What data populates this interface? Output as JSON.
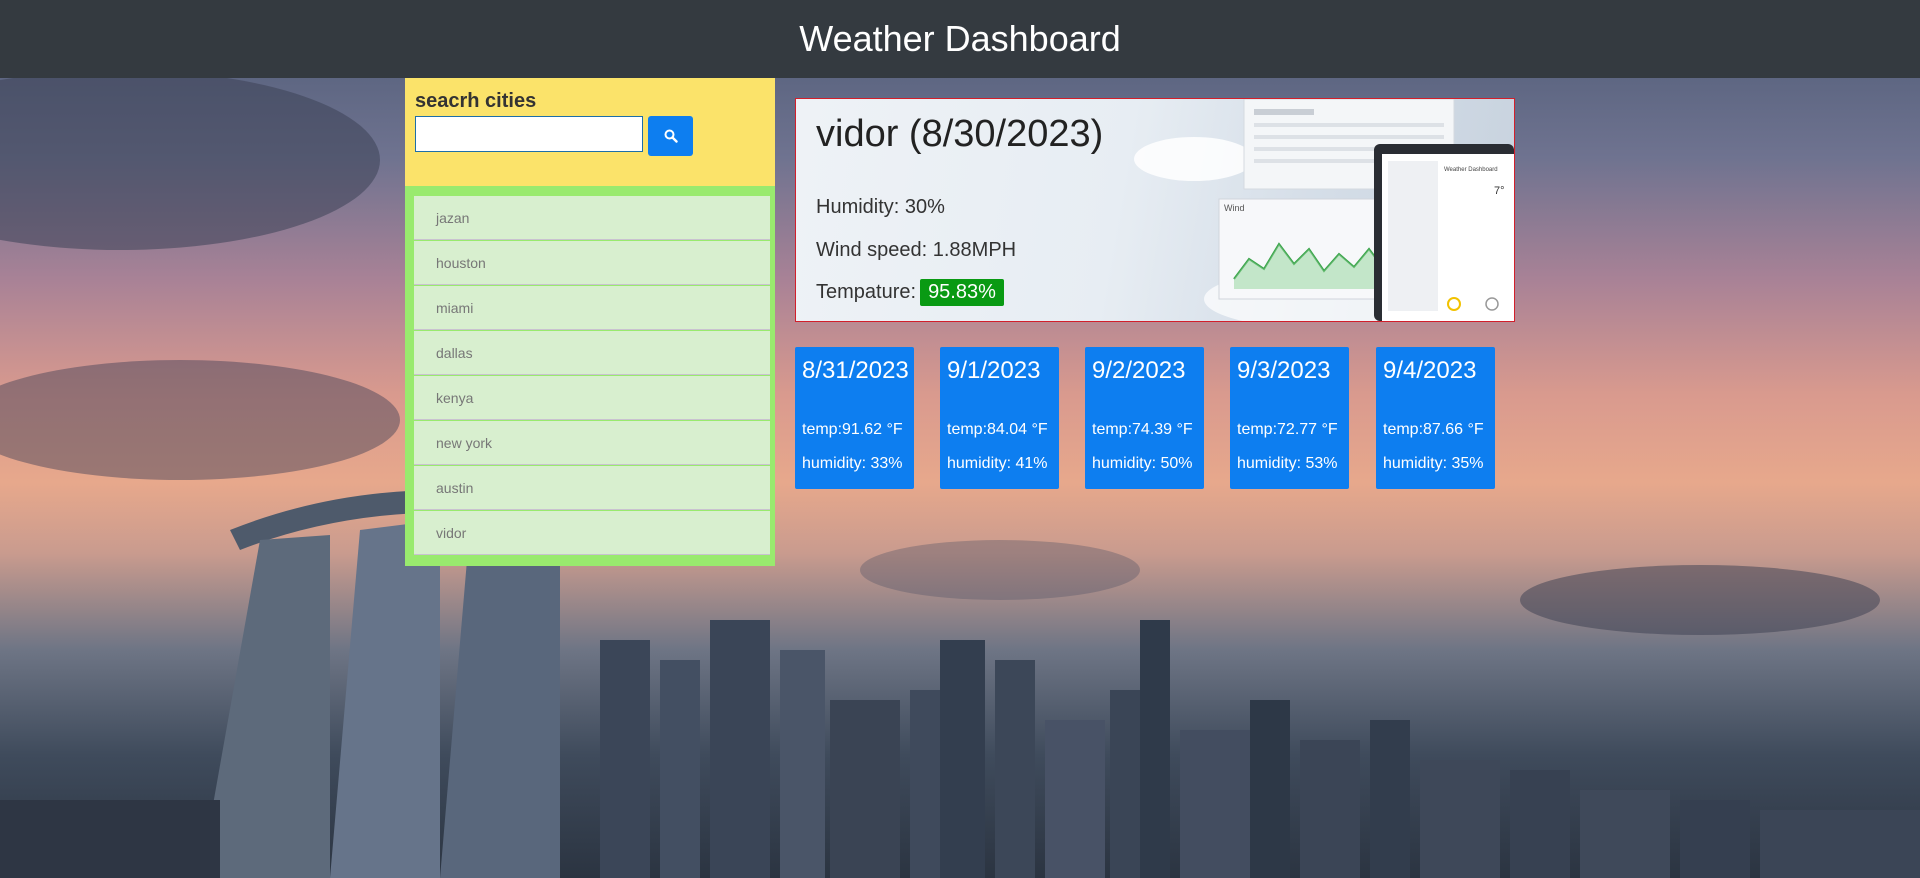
{
  "header": {
    "title": "Weather Dashboard"
  },
  "search": {
    "label": "seacrh cities",
    "value": ""
  },
  "history": [
    "jazan",
    "houston",
    "miami",
    "dallas",
    "kenya",
    "new york",
    "austin",
    "vidor"
  ],
  "current": {
    "title": "vidor (8/30/2023)",
    "humidity": "Humidity: 30%",
    "wind": "Wind speed: 1.88MPH",
    "temp_label": "Tempature:",
    "temp_value": "95.83%"
  },
  "forecast": [
    {
      "date": "8/31/2023",
      "temp": "temp:91.62 °F",
      "humidity": "humidity: 33%"
    },
    {
      "date": "9/1/2023",
      "temp": "temp:84.04 °F",
      "humidity": "humidity: 41%"
    },
    {
      "date": "9/2/2023",
      "temp": "temp:74.39 °F",
      "humidity": "humidity: 50%"
    },
    {
      "date": "9/3/2023",
      "temp": "temp:72.77 °F",
      "humidity": "humidity: 53%"
    },
    {
      "date": "9/4/2023",
      "temp": "temp:87.66 °F",
      "humidity": "humidity: 35%"
    }
  ],
  "colors": {
    "header": "#343a40",
    "search_panel": "#fbe36a",
    "history_panel": "#99ea6e",
    "forecast_card": "#0d7ef0",
    "temp_badge": "#099a13"
  },
  "icons": {
    "search": "search-icon"
  }
}
